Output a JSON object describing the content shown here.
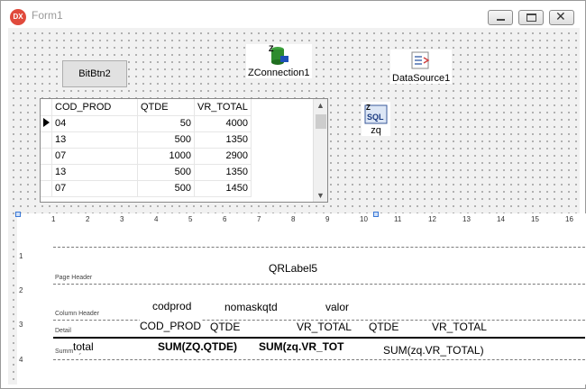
{
  "window": {
    "logo": "DX",
    "title": "Form1",
    "buttons": [
      {
        "name": "minimize",
        "icon": "minimize-icon"
      },
      {
        "name": "maximize",
        "icon": "maximize-icon"
      },
      {
        "name": "close",
        "icon": "close-icon",
        "glyph": "✕"
      }
    ]
  },
  "components": {
    "bitbtn": "BitBtn2",
    "zconnection": "ZConnection1",
    "datasource": "DataSource1",
    "zq": "zq",
    "zq_icon_text": "SQL"
  },
  "grid": {
    "columns": [
      "COD_PROD",
      "QTDE",
      "VR_TOTAL"
    ],
    "rows": [
      {
        "current": true,
        "cod_prod": "04",
        "qtde": "50",
        "vr_total": "4000"
      },
      {
        "current": false,
        "cod_prod": "13",
        "qtde": "500",
        "vr_total": "1350"
      },
      {
        "current": false,
        "cod_prod": "07",
        "qtde": "1000",
        "vr_total": "2900"
      },
      {
        "current": false,
        "cod_prod": "13",
        "qtde": "500",
        "vr_total": "1350"
      },
      {
        "current": false,
        "cod_prod": "07",
        "qtde": "500",
        "vr_total": "1450"
      }
    ]
  },
  "report": {
    "ruler_ticks": [
      "1",
      "2",
      "3",
      "4",
      "5",
      "6",
      "7",
      "8",
      "9",
      "10",
      "11",
      "12",
      "13",
      "14",
      "15",
      "16"
    ],
    "vruler_ticks": [
      "1",
      "2",
      "3",
      "4"
    ],
    "bands": {
      "page_header": "Page Header",
      "column_header": "Column Header",
      "detail": "Detail",
      "summary": "Summary"
    },
    "labels": {
      "qrlabel5": "QRLabel5",
      "codprod": "codprod",
      "nomaskqtd": "nomaskqtd",
      "valor": "valor",
      "cod_prod": "COD_PROD",
      "qtde_1": "QTDE",
      "vr_total_1": "VR_TOTAL",
      "qtde_2": "QTDE",
      "vr_total_2": "VR_TOTAL",
      "total": "total",
      "sum_qtde": "SUM(ZQ.QTDE)",
      "sum_vr_bold": "SUM(zq.VR_TOT",
      "sum_vr": "SUM(zq.VR_TOTAL)"
    }
  }
}
